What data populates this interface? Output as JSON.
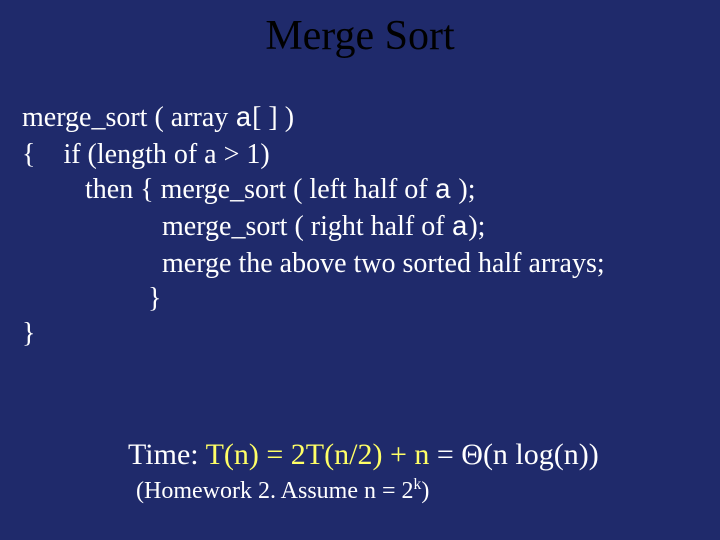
{
  "title": "Merge Sort",
  "code": {
    "l1a": "merge_sort ( array ",
    "l1b": "a",
    "l1c": "[ ] )",
    "l2": "{    if  (length of a > 1)",
    "l3a": "         then { merge_sort ( left half of ",
    "l3b": "a",
    "l3c": " );",
    "l4a": "                    merge_sort ( right half of ",
    "l4b": "a",
    "l4c": ");",
    "l5": "                    merge the above two sorted half arrays;",
    "l6": "                  }",
    "l7": "}"
  },
  "time": {
    "label": "Time: ",
    "lhs": "T(n) = ",
    "rec": "2T(n/2) + n",
    "rhs": "  = Θ(n log(n))"
  },
  "hw": {
    "a": "(Homework 2.  Assume n = 2",
    "sup": "k",
    "b": ")"
  }
}
